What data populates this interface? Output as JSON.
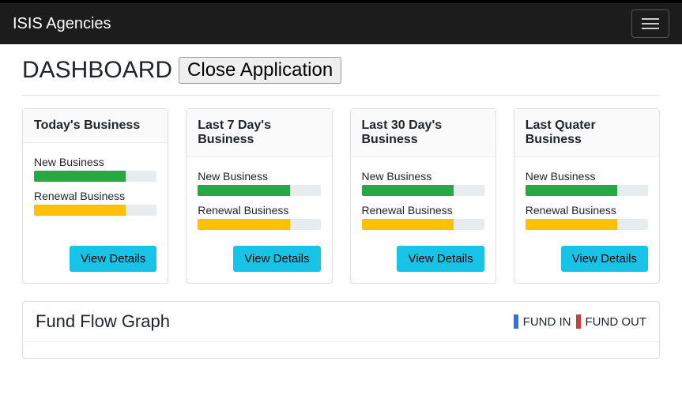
{
  "navbar": {
    "brand": "ISIS Agencies"
  },
  "header": {
    "title": "DASHBOARD",
    "close_label": "Close Application"
  },
  "cards": [
    {
      "title": "Today's Business",
      "new_label": "New Business",
      "new_pct": 75,
      "renewal_label": "Renewal Business",
      "renewal_pct": 75,
      "view_label": "View Details"
    },
    {
      "title": "Last 7 Day's Business",
      "new_label": "New Business",
      "new_pct": 75,
      "renewal_label": "Renewal Business",
      "renewal_pct": 75,
      "view_label": "View Details"
    },
    {
      "title": "Last 30 Day's Business",
      "new_label": "New Business",
      "new_pct": 75,
      "renewal_label": "Renewal Business",
      "renewal_pct": 75,
      "view_label": "View Details"
    },
    {
      "title": "Last Quater Business",
      "new_label": "New Business",
      "new_pct": 75,
      "renewal_label": "Renewal Business",
      "renewal_pct": 75,
      "view_label": "View Details"
    }
  ],
  "fund": {
    "title": "Fund Flow Graph",
    "legend": [
      {
        "label": "FUND IN",
        "color": "#3b6fd6"
      },
      {
        "label": "FUND OUT",
        "color": "#d63b3b"
      }
    ]
  },
  "chart_data": {
    "type": "bar",
    "title": "Fund Flow Graph",
    "series": [
      {
        "name": "FUND IN",
        "values": []
      },
      {
        "name": "FUND OUT",
        "values": []
      }
    ],
    "categories": []
  }
}
